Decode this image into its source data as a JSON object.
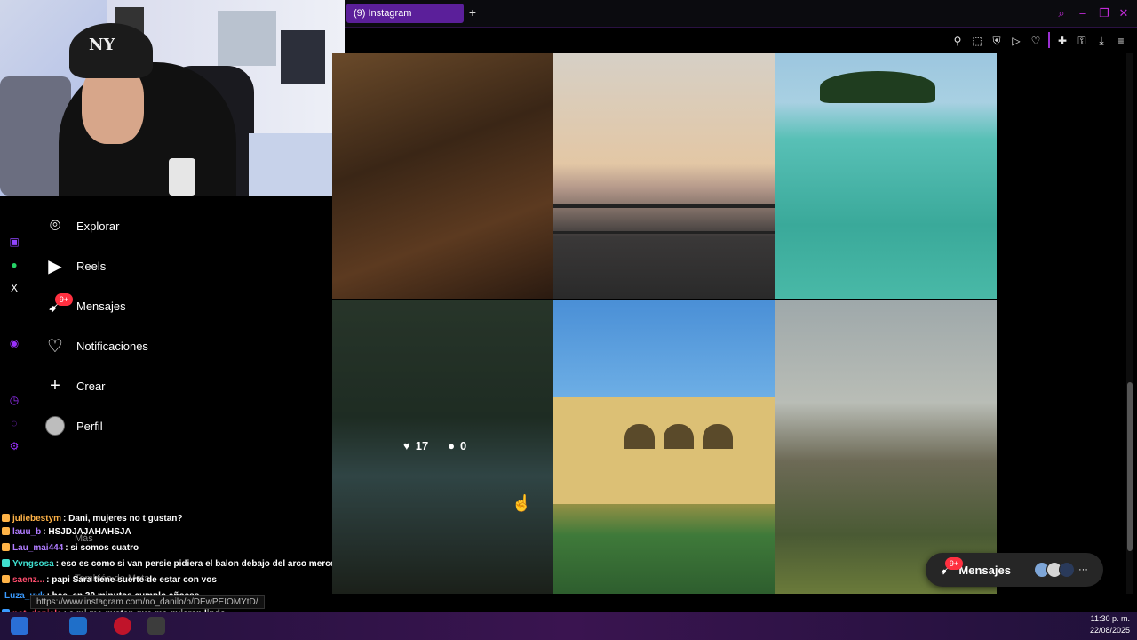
{
  "browser": {
    "tab_title": "(9) Instagram",
    "new_tab": "+"
  },
  "sidebar": {
    "items": [
      {
        "label": "Explorar",
        "icon": "compass-icon"
      },
      {
        "label": "Reels",
        "icon": "reels-icon"
      },
      {
        "label": "Mensajes",
        "icon": "messenger-icon",
        "badge": "9+"
      },
      {
        "label": "Notificaciones",
        "icon": "heart-icon"
      },
      {
        "label": "Crear",
        "icon": "plus-icon"
      },
      {
        "label": "Perfil",
        "icon": "avatar"
      }
    ]
  },
  "grid": {
    "hover_likes": "17",
    "hover_comments": "0"
  },
  "messages_pill": {
    "label": "Mensajes",
    "badge": "9+"
  },
  "chat": {
    "lines": [
      {
        "user": "juliebestym",
        "msg": ": Dani, mujeres no t gustan?",
        "color": "#ffb347"
      },
      {
        "user": "lauu_b",
        "msg": ": HSJDJAJAHAHSJA",
        "color": "#b07cff"
      },
      {
        "user": "Lau_mai444",
        "msg": ": si somos cuatro",
        "color": "#b07cff"
      },
      {
        "user": "Yvngsosa",
        "msg": ": eso es como si van persie pidiera el balon debajo del arco mercenario",
        "color": "#3fe0d0"
      },
      {
        "user": "saenz...",
        "msg": ": papi Sara tiene suerte de estar con vos",
        "color": "#ff4d6d"
      },
      {
        "user": "Luza_uvk",
        "msg": ": hee, en 30 minutos cumplo añosss",
        "color": "#3a9bff"
      },
      {
        "user": "not_daniela",
        "msg": ": a mi me gustan que me quieran lindo",
        "color": "#ff4d6d"
      }
    ],
    "partial": [
      "Más",
      "También de Meta"
    ],
    "url_tooltip": "https://www.instagram.com/no_danilo/p/DEwPEIOMYtD/"
  },
  "taskbar": {
    "time": "11:30 p. m.",
    "date": "22/08/2025"
  },
  "colors": {
    "accent": "#5b1f9a",
    "badge": "#ff3040"
  }
}
